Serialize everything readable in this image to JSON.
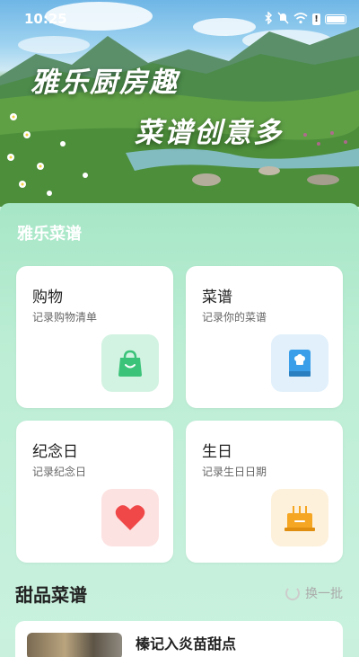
{
  "status_bar": {
    "time": "10:25",
    "icons": [
      "bluetooth-icon",
      "mute-icon",
      "wifi-icon",
      "alert-icon",
      "battery-icon"
    ],
    "alert_badge": "!"
  },
  "hero": {
    "line1": "雅乐厨房趣",
    "line2": "菜谱创意多"
  },
  "section": {
    "title": "雅乐菜谱"
  },
  "cards": [
    {
      "title": "购物",
      "subtitle": "记录购物清单",
      "icon": "shopping-bag-icon",
      "icon_bg": "#d3f3e2",
      "icon_color": "#3cc37a"
    },
    {
      "title": "菜谱",
      "subtitle": "记录你的菜谱",
      "icon": "recipe-book-icon",
      "icon_bg": "#e1f0fb",
      "icon_color": "#3a9fe8"
    },
    {
      "title": "纪念日",
      "subtitle": "记录纪念日",
      "icon": "heart-icon",
      "icon_bg": "#fde2e2",
      "icon_color": "#f04848"
    },
    {
      "title": "生日",
      "subtitle": "记录生日日期",
      "icon": "birthday-cake-icon",
      "icon_bg": "#fdf1dc",
      "icon_color": "#f5a623"
    }
  ],
  "dessert": {
    "title": "甜品菜谱",
    "refresh_label": "换一批",
    "first_recipe": "榛记入炎苗甜点"
  },
  "colors": {
    "content_bg": "#bdeed5",
    "card_bg": "#ffffff"
  }
}
